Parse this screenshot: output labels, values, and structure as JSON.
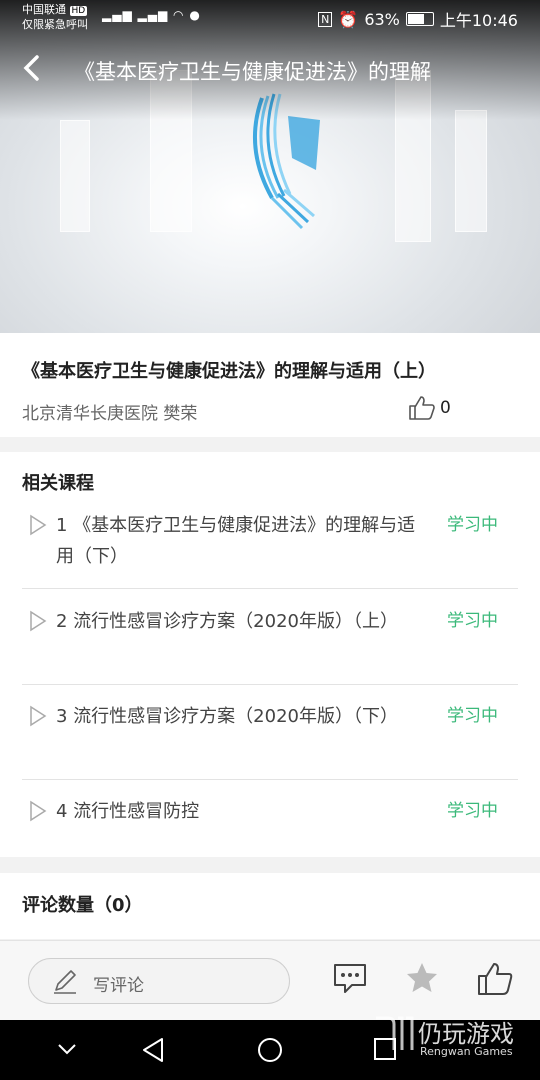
{
  "status_bar": {
    "carrier_line1": "中国联通",
    "carrier_hd": "HD",
    "carrier_line2": "仅限紧急呼叫",
    "battery": "63%",
    "time": "上午10:46"
  },
  "header": {
    "back_icon": "chevron-left-icon",
    "title": "《基本医疗卫生与健康促进法》的理解"
  },
  "lesson": {
    "title": "《基本医疗卫生与健康促进法》的理解与适用（上）",
    "author": "北京清华长庚医院 樊荣",
    "like_count": "0"
  },
  "related": {
    "heading": "相关课程",
    "items": [
      {
        "number": "1",
        "title": "《基本医疗卫生与健康促进法》的理解与适用（下）",
        "status": "学习中"
      },
      {
        "number": "2",
        "title": "流行性感冒诊疗方案（2020年版）（上）",
        "status": "学习中"
      },
      {
        "number": "3",
        "title": "流行性感冒诊疗方案（2020年版）（下）",
        "status": "学习中"
      },
      {
        "number": "4",
        "title": "流行性感冒防控",
        "status": "学习中"
      }
    ]
  },
  "comments": {
    "heading": "评论数量（0）"
  },
  "bottom_bar": {
    "write_placeholder": "写评论",
    "icons": [
      "comment-icon",
      "star-icon",
      "thumbs-up-icon"
    ]
  },
  "watermark": {
    "name": "仍玩游戏",
    "sub": "Rengwan Games"
  },
  "colors": {
    "accent_green": "#3bb97a",
    "text_dark": "#222222",
    "text_muted": "#666666"
  }
}
